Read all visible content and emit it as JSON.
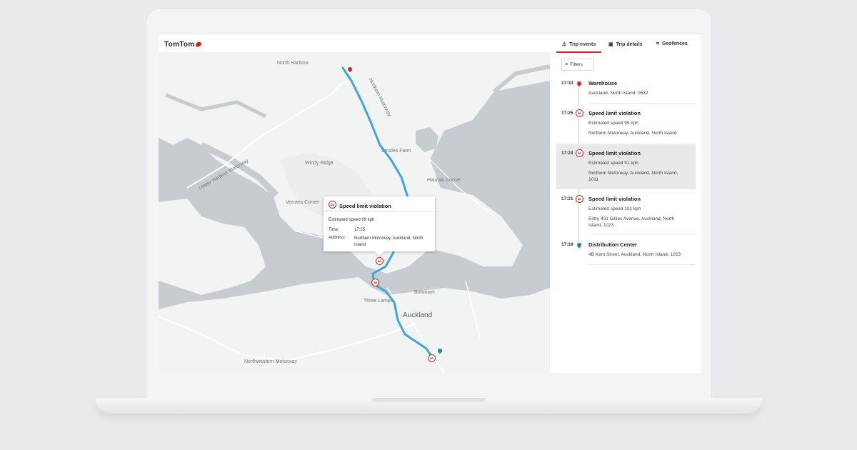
{
  "brand": {
    "logo_text": "TomTom",
    "accent_color": "#d3281f"
  },
  "tabs": [
    {
      "label": "Trip events",
      "icon": "warning-triangle-icon",
      "active": true
    },
    {
      "label": "Trip details",
      "icon": "briefcase-icon",
      "active": false
    },
    {
      "label": "Geofences",
      "icon": "geofence-icon",
      "active": false
    }
  ],
  "filters": {
    "label": "Filters",
    "icon": "filter-lines-icon"
  },
  "events": [
    {
      "time": "17:33",
      "icon": "location-pin-icon",
      "title": "Warehouse",
      "lines": [
        "Auckland, North Island, 0632"
      ],
      "selected": false
    },
    {
      "time": "17:25",
      "icon": "speed-limit-icon",
      "badge": "80",
      "title": "Speed limit violation",
      "lines": [
        "Estimated speed 99 kph",
        "Northern Motorway, Auckland, North Island"
      ],
      "selected": false
    },
    {
      "time": "17:24",
      "icon": "speed-limit-icon",
      "badge": "80",
      "title": "Speed limit violation",
      "lines": [
        "Estimated speed 91 kph",
        "Northern Motorway, Auckland, North Island, 1011"
      ],
      "selected": true
    },
    {
      "time": "17:21",
      "icon": "speed-limit-icon",
      "badge": "80",
      "title": "Speed limit violation",
      "lines": [
        "Estimated speed 101 kph",
        "Entry 431 Gillies Avenue, Auckland, North Island, 1023"
      ],
      "selected": false
    },
    {
      "time": "17:18",
      "icon": "location-pin-icon",
      "title": "Distribution Center",
      "lines": [
        "4B Kent Street, Auckland, North Island, 1023"
      ],
      "selected": false
    }
  ],
  "popup": {
    "badge": "80",
    "title": "Speed limit violation",
    "estimated": "Estimated speed 99 kph",
    "time_label": "Time:",
    "time_value": "17:25",
    "address_label": "Address:",
    "address_value": "Northern Motorway, Auckland, North Island"
  },
  "map": {
    "place_labels": [
      "North Harbour",
      "Smales Farm",
      "Windy Ridge",
      "Hauraki Corner",
      "Verrans Corner",
      "Three Lamps",
      "Britomart",
      "Auckland"
    ],
    "road_labels": [
      "Northwestern Motorway",
      "Upper Harbour Motorway",
      "Northern Motorway"
    ],
    "markers": [
      {
        "type": "speed-limit",
        "badge": "80"
      },
      {
        "type": "speed-limit",
        "badge": "80"
      },
      {
        "type": "speed-limit",
        "badge": "80"
      }
    ],
    "route_color": "#3ea6dd"
  }
}
